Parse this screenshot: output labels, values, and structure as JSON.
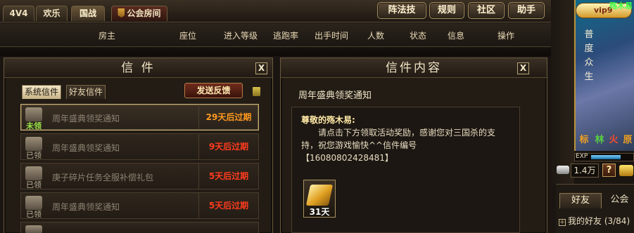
{
  "top_tabs": [
    {
      "label": "4V4"
    },
    {
      "label": "欢乐"
    },
    {
      "label": "国战"
    },
    {
      "label": "公会房间"
    }
  ],
  "top_buttons": [
    {
      "label": "阵法技"
    },
    {
      "label": "规则"
    },
    {
      "label": "社区"
    },
    {
      "label": "助手"
    }
  ],
  "room_columns": [
    "房主",
    "座位",
    "进入等级",
    "逃跑率",
    "出手时间",
    "人数",
    "状态",
    "信息",
    "操作"
  ],
  "mail_panel": {
    "title": "信 件",
    "close": "X",
    "subtabs": [
      "系统信件",
      "好友信件"
    ],
    "feedback_button": "发送反馈",
    "rows": [
      {
        "subject": "周年盛典领奖通知",
        "state": "未领",
        "expire": "29天后过期",
        "expire_color": "#ff9a1e"
      },
      {
        "subject": "周年盛典领奖通知",
        "state": "已领",
        "expire": "9天后过期",
        "expire_color": "#ff3b1e"
      },
      {
        "subject": "庚子碎片任务全服补偿礼包",
        "state": "已领",
        "expire": "5天后过期",
        "expire_color": "#ff3b1e"
      },
      {
        "subject": "周年盛典领奖通知",
        "state": "已领",
        "expire": "5天后过期",
        "expire_color": "#ff3b1e"
      }
    ]
  },
  "content_panel": {
    "title": "信件内容",
    "close": "X",
    "heading": "周年盛典领奖通知",
    "greeting": "尊敬的殇木易:",
    "body": "请点击下方领取活动奖励，感谢您对三国杀的支持，祝您游戏愉快^^信件编号【16080802428481】",
    "reward_label": "31天"
  },
  "profile": {
    "vip": "vip9",
    "name_tag": "殇木易",
    "character_name": "普度众生",
    "kingdom_chars": [
      "标",
      "林",
      "火",
      "原"
    ],
    "exp_label": "EXP",
    "exp_fraction": 0.72,
    "silver": "1.4万",
    "help": "?"
  },
  "friends": {
    "tabs": [
      "好友",
      "公会"
    ],
    "group": "我的好友 (3/84)"
  }
}
